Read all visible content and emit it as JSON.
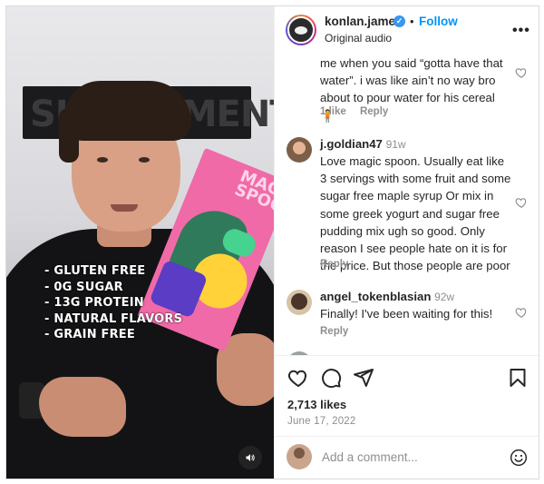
{
  "post": {
    "username": "konlan.james",
    "verified": true,
    "follow_label": "Follow",
    "separator": "•",
    "audio_label": "Original audio",
    "more_label": "•••",
    "video_overlay": [
      "- GLUTEN FREE",
      "- 0G SUGAR",
      "- 13G PROTEIN",
      "- NATURAL FLAVORS",
      "- GRAIN FREE"
    ]
  },
  "comments": [
    {
      "username": "",
      "text": "me when you said “gotta have that water”. i was like ain’t no way bro about to pour water for his cereal 🧍",
      "likes_label": "1 like",
      "reply_label": "Reply"
    },
    {
      "username": "j.goldian47",
      "time": "91w",
      "text": "Love magic spoon. Usually eat like 3 servings with some fruit and some sugar free maple syrup Or mix in some greek yogurt and sugar free pudding mix ugh so good. Only reason I see people hate on it is for the price. But those people are poor",
      "reply_label": "Reply"
    },
    {
      "username": "angel_tokenblasian",
      "time": "92w",
      "text": "Finally! I've been waiting for this!",
      "reply_label": "Reply"
    }
  ],
  "stats": {
    "likes": "2,713 likes",
    "date": "June 17, 2022"
  },
  "composer": {
    "placeholder": "Add a comment..."
  },
  "colors": {
    "accent": "#0095f6",
    "text": "#262626",
    "muted": "#8e8e8e"
  },
  "icons": [
    "verified-badge-icon",
    "more-icon",
    "heart-icon",
    "comment-icon",
    "share-icon",
    "bookmark-icon",
    "emoji-icon",
    "speaker-icon"
  ]
}
